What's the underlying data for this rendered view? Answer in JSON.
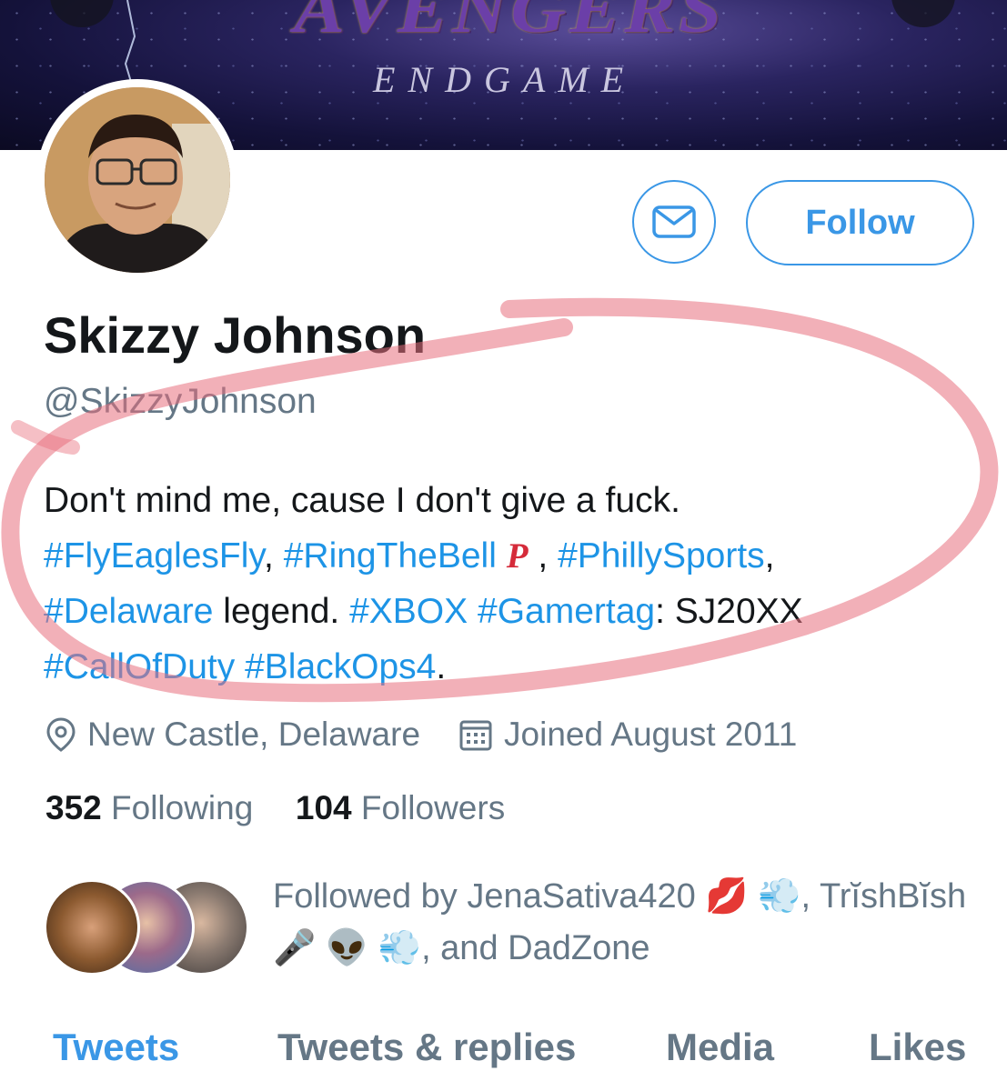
{
  "banner": {
    "title": "AVENGERS",
    "subtitle": "ENDGAME"
  },
  "profile": {
    "display_name": "Skizzy Johnson",
    "handle": "@SkizzyJohnson",
    "bio": {
      "line1": "Don't mind me, cause I don't give a fuck.",
      "tag_fly": "#FlyEaglesFly",
      "comma1": ",",
      "tag_bell": "#RingTheBell",
      "phillies_logo": "P",
      "comma2": ",",
      "tag_philly": "#PhillySports",
      "comma3": ",",
      "tag_delaware": "#Delaware",
      "legend_text": "legend.",
      "tag_xbox": "#XBOX",
      "tag_gamertag": "#Gamertag",
      "gamertag_value": ": SJ20XX",
      "tag_cod": "#CallOfDuty",
      "tag_bo4": "#BlackOps4",
      "period": "."
    },
    "location": "New Castle, Delaware",
    "joined": "Joined August 2011",
    "following_count": "352",
    "following_label": "Following",
    "followers_count": "104",
    "followers_label": "Followers"
  },
  "actions": {
    "message_icon": "envelope-icon",
    "follow_label": "Follow"
  },
  "followed_by": {
    "prefix": "Followed by",
    "user1": "JenaSativa420",
    "user1_emoji": "💋 💨",
    "comma": ",",
    "user2": "TrĭshBĭsh",
    "user2_emoji": "🎤 👽 💨",
    "suffix": ", and",
    "user3": "DadZone"
  },
  "tabs": [
    {
      "label": "Tweets",
      "active": true
    },
    {
      "label": "Tweets & replies",
      "active": false
    },
    {
      "label": "Media",
      "active": false
    },
    {
      "label": "Likes",
      "active": false
    }
  ],
  "colors": {
    "accent": "#3a97e6",
    "hashtag": "#1d94e6",
    "muted": "#657786",
    "annotation": "#e8707e"
  }
}
